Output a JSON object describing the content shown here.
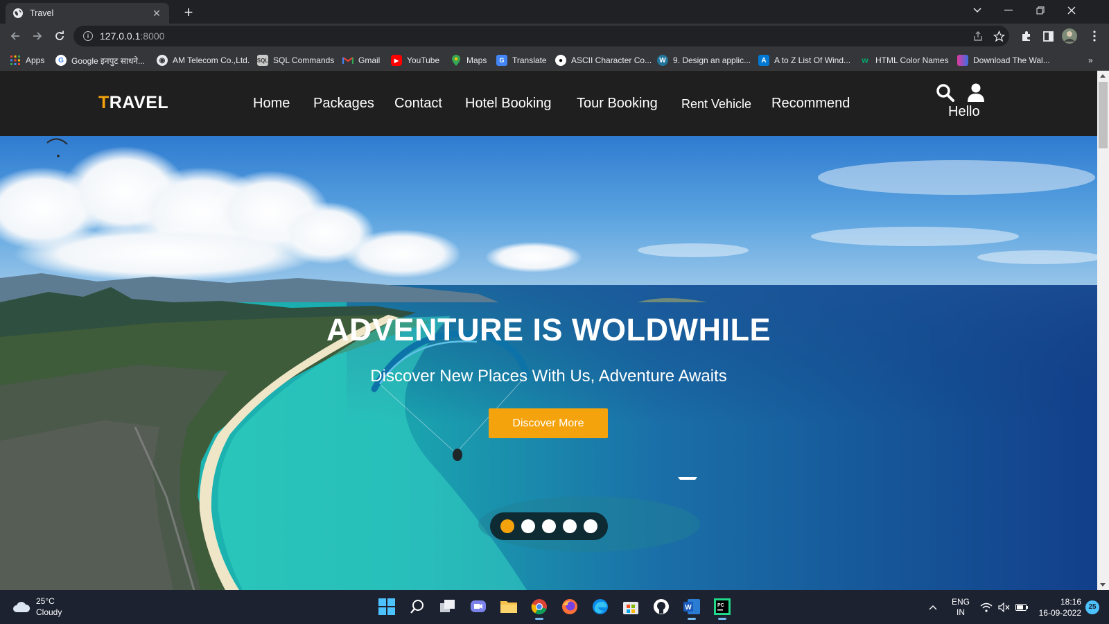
{
  "browser": {
    "tab_title": "Travel",
    "url_host": "127.0.0.1",
    "url_port": ":8000"
  },
  "bookmarks": [
    {
      "label": "Apps",
      "icon": "apps-grid-icon"
    },
    {
      "label": "Google इनपुट साधने...",
      "icon": "google-icon"
    },
    {
      "label": "AM Telecom Co.,Ltd.",
      "icon": "globe-icon"
    },
    {
      "label": "SQL Commands",
      "icon": "sql-icon"
    },
    {
      "label": "Gmail",
      "icon": "gmail-icon"
    },
    {
      "label": "YouTube",
      "icon": "youtube-icon"
    },
    {
      "label": "Maps",
      "icon": "maps-icon"
    },
    {
      "label": "Translate",
      "icon": "translate-icon"
    },
    {
      "label": "ASCII Character Co...",
      "icon": "ascii-icon"
    },
    {
      "label": "9. Design an applic...",
      "icon": "wordpress-icon"
    },
    {
      "label": "A to Z List Of Wind...",
      "icon": "windows-list-icon"
    },
    {
      "label": "HTML Color Names",
      "icon": "w3-icon"
    },
    {
      "label": "Download The Wal...",
      "icon": "download-icon"
    }
  ],
  "site": {
    "logo_first": "T",
    "logo_rest": "RAVEL",
    "nav": [
      "Home",
      "Packages",
      "Contact",
      "Hotel Booking",
      "Tour Booking",
      "Rent Vehicle",
      "Recommend"
    ],
    "user_greeting": "Hello"
  },
  "hero": {
    "title": "ADVENTURE IS WOLDWHILE",
    "subtitle": "Discover New Places With Us, Adventure Awaits",
    "cta_label": "Discover More",
    "slide_count": 5,
    "active_slide": 1
  },
  "colors": {
    "accent": "#f5a30c",
    "header_bg": "#1f1f1f",
    "dots_bg": "#0e2a33"
  },
  "taskbar": {
    "temperature": "25°C",
    "condition": "Cloudy",
    "language_1": "ENG",
    "language_2": "IN",
    "time": "18:16",
    "date": "16-09-2022",
    "notifications": "25"
  }
}
